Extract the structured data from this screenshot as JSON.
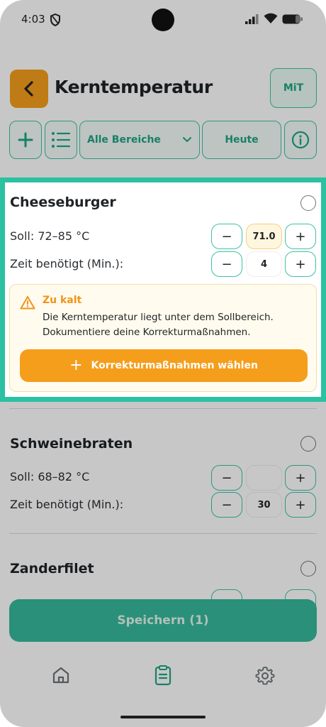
{
  "status_bar": {
    "time": "4:03"
  },
  "header": {
    "title": "Kerntemperatur",
    "mit_label": "MiT"
  },
  "toolbar": {
    "area_select": "Alle Bereiche",
    "date_filter": "Heute"
  },
  "items": [
    {
      "name": "Cheeseburger",
      "target_label": "Soll: 72–85 °C",
      "target_value": "71.0",
      "time_label": "Zeit benötigt (Min.):",
      "time_value": "4",
      "warning": {
        "title": "Zu kalt",
        "line1": "Die Kerntemperatur liegt unter dem Sollbereich.",
        "line2": "Dokumentiere deine Korrekturmaßnahmen.",
        "action_label": "Korrekturmaßnahmen wählen"
      }
    },
    {
      "name": "Schweinebraten",
      "target_label": "Soll: 68–82 °C",
      "target_value": "",
      "time_label": "Zeit benötigt (Min.):",
      "time_value": "30"
    },
    {
      "name": "Zanderfilet"
    }
  ],
  "stepper": {
    "minus": "−",
    "plus": "+"
  },
  "save_label": "Speichern (1)",
  "colors": {
    "accent": "#2bc1a2",
    "warning": "#f59e1b",
    "warning_bg": "#fffbee"
  },
  "icons": {
    "back": "chevron-left-icon",
    "add": "plus-icon",
    "list": "list-icon",
    "dropdown": "chevron-down-icon",
    "info": "info-icon",
    "warning": "warning-triangle-icon",
    "nav_home": "home-icon",
    "nav_checklist": "clipboard-icon",
    "nav_settings": "gear-icon"
  }
}
